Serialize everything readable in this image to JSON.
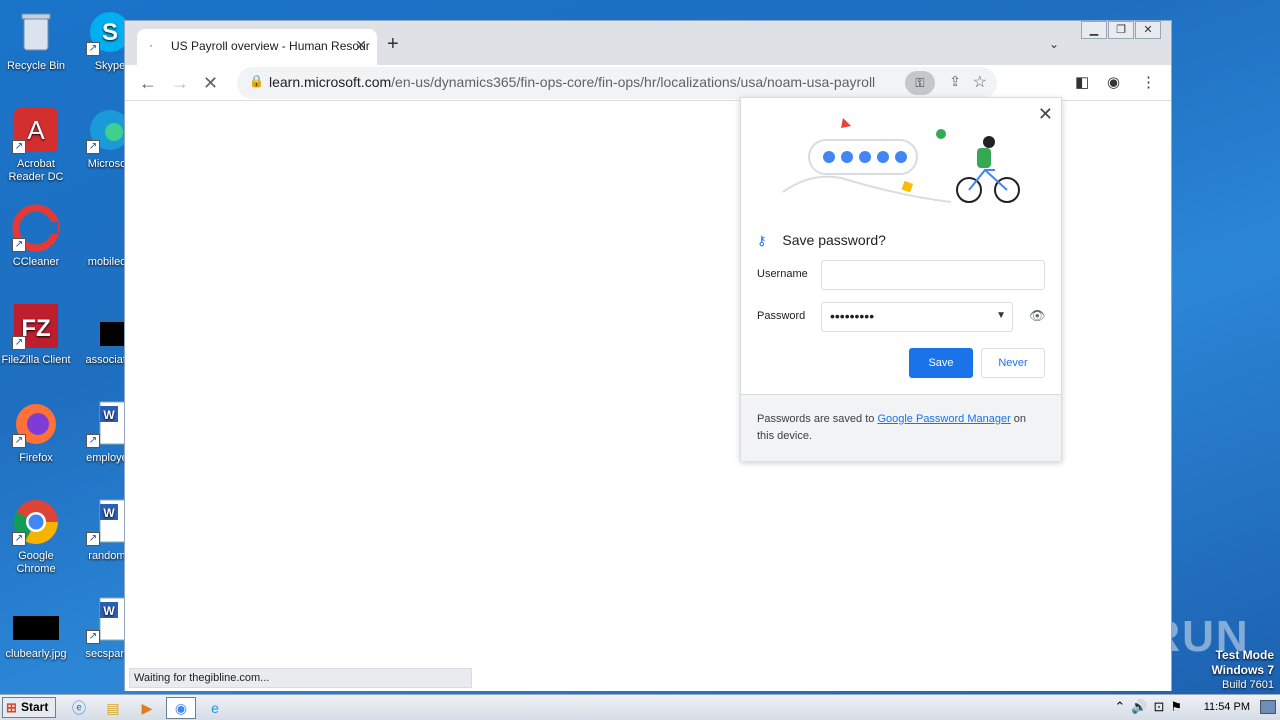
{
  "desktop": {
    "icons": [
      {
        "label": "Recycle Bin",
        "glyph": "🗑",
        "color": "#cfd8e3"
      },
      {
        "label": "Skype",
        "glyph": "S",
        "color": "#00aff0"
      },
      {
        "label": "Acrobat Reader DC",
        "glyph": "A",
        "color": "#d32f2f"
      },
      {
        "label": "Microsoft",
        "glyph": "e",
        "color": "#0f7bd4"
      },
      {
        "label": "CCleaner",
        "glyph": "C",
        "color": "#e53935"
      },
      {
        "label": "mobileoff",
        "glyph": "",
        "color": "#1f6fc0"
      },
      {
        "label": "FileZilla Client",
        "glyph": "FZ",
        "color": "#bf1e2e"
      },
      {
        "label": "associatio",
        "glyph": "",
        "color": "#000000"
      },
      {
        "label": "Firefox",
        "glyph": "🦊",
        "color": "#ff7139"
      },
      {
        "label": "employee",
        "glyph": "W",
        "color": "#ffffff"
      },
      {
        "label": "Google Chrome",
        "glyph": "◉",
        "color": "#4285f4"
      },
      {
        "label": "randoma",
        "glyph": "W",
        "color": "#ffffff"
      },
      {
        "label": "clubearly.jpg",
        "glyph": "",
        "color": "#000000"
      },
      {
        "label": "secspanis",
        "glyph": "W",
        "color": "#ffffff"
      }
    ]
  },
  "browser": {
    "tab_title": "US Payroll overview - Human Resour",
    "url_host": "learn.microsoft.com",
    "url_path": "/en-us/dynamics365/fin-ops-core/fin-ops/hr/localizations/usa/noam-usa-payroll",
    "status_text": "Waiting for thegibline.com..."
  },
  "password_bubble": {
    "title": "Save password?",
    "username_label": "Username",
    "username_value": "",
    "password_label": "Password",
    "password_value": "•••••••••",
    "save_label": "Save",
    "never_label": "Never",
    "footer_prefix": "Passwords are saved to ",
    "footer_link": "Google Password Manager",
    "footer_suffix": " on this device."
  },
  "taskbar": {
    "start_label": "Start",
    "clock": "11:54 PM"
  },
  "overlay": {
    "watermark": "ANY RUN",
    "test_mode": "Test Mode",
    "os_name": "Windows 7",
    "build": "Build 7601"
  }
}
